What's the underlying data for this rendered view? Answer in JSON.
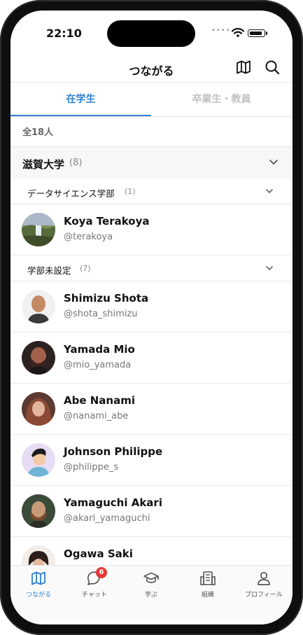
{
  "status_bar": {
    "time": "22:10",
    "signal_dots": "••••"
  },
  "header": {
    "title": "つながる",
    "map_icon": "map-icon",
    "search_icon": "search-icon"
  },
  "tabs": [
    {
      "label": "在学生",
      "active": true
    },
    {
      "label": "卒業生・教員",
      "active": false
    }
  ],
  "total_count": "全18人",
  "group": {
    "name": "滋賀大学",
    "count": "(8)"
  },
  "subgroups": [
    {
      "name": "データサイエンス学部",
      "count": "(1)"
    },
    {
      "name": "学部未設定",
      "count": "(7)"
    }
  ],
  "members": [
    {
      "name": "Koya Terakoya",
      "handle": "@terakoya"
    },
    {
      "name": "Shimizu Shota",
      "handle": "@shota_shimizu"
    },
    {
      "name": "Yamada Mio",
      "handle": "@mio_yamada"
    },
    {
      "name": "Abe Nanami",
      "handle": "@nanami_abe"
    },
    {
      "name": "Johnson Philippe",
      "handle": "@philippe_s"
    },
    {
      "name": "Yamaguchi Akari",
      "handle": "@akari_yamaguchi"
    },
    {
      "name": "Ogawa Saki",
      "handle": ""
    }
  ],
  "tabbar": [
    {
      "label": "つながる",
      "icon": "map-icon",
      "active": true
    },
    {
      "label": "チャット",
      "icon": "chat-icon",
      "badge": "6"
    },
    {
      "label": "学ぶ",
      "icon": "graduation-cap-icon"
    },
    {
      "label": "組織",
      "icon": "building-icon"
    },
    {
      "label": "プロフィール",
      "icon": "person-icon"
    }
  ],
  "colors": {
    "accent": "#2f7fd0",
    "badge": "#e53935"
  }
}
